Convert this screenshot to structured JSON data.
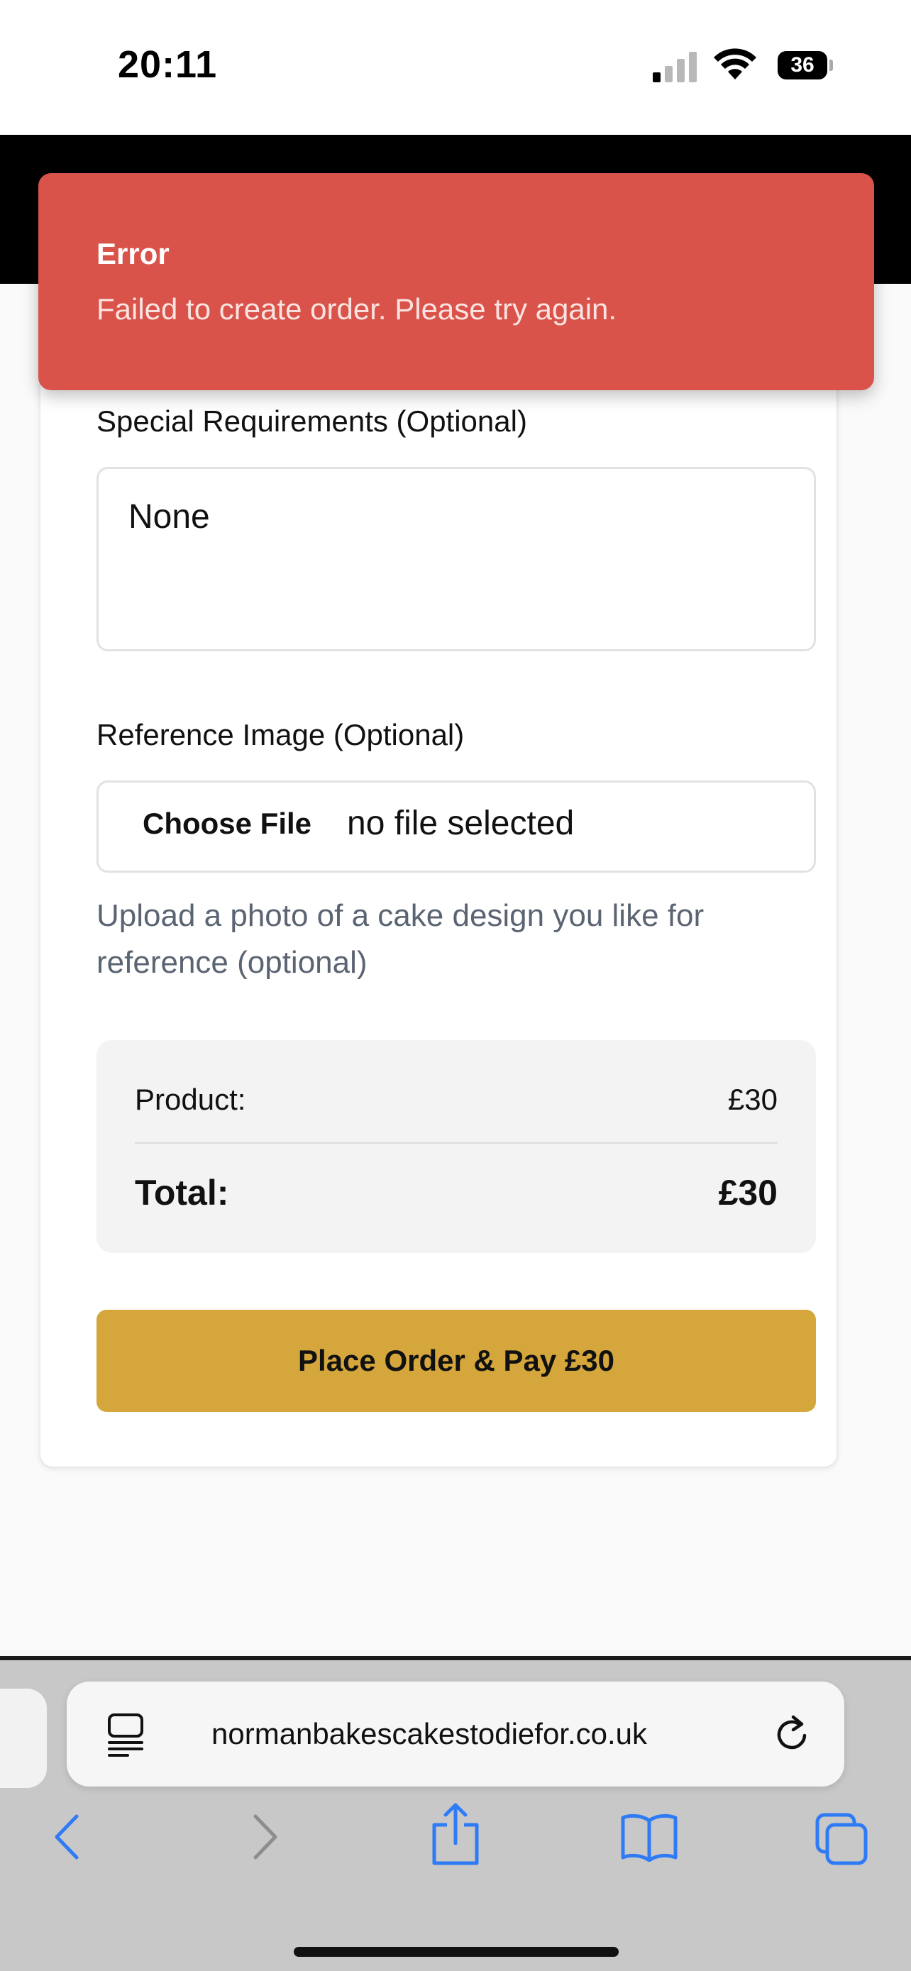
{
  "status_bar": {
    "time": "20:11",
    "battery": "36"
  },
  "toast": {
    "title": "Error",
    "message": "Failed to create order. Please try again."
  },
  "form": {
    "special_requirements_label": "Special Requirements (Optional)",
    "special_requirements_value": "None",
    "reference_image_label": "Reference Image (Optional)",
    "choose_file_label": "Choose File",
    "file_status": "no file selected",
    "reference_help": "Upload a photo of a cake design you like for reference (optional)"
  },
  "summary": {
    "product_label": "Product:",
    "product_value": "£30",
    "total_label": "Total:",
    "total_value": "£30"
  },
  "actions": {
    "place_order_label": "Place Order & Pay £30"
  },
  "browser": {
    "url": "normanbakescakestodiefor.co.uk",
    "accent_color": "#2f7bf6",
    "toolbar_icons": [
      "back-icon",
      "forward-icon",
      "share-icon",
      "bookmarks-icon",
      "tabs-icon"
    ]
  },
  "colors": {
    "error": "#d9534a",
    "primary_button": "#d4a63c"
  }
}
